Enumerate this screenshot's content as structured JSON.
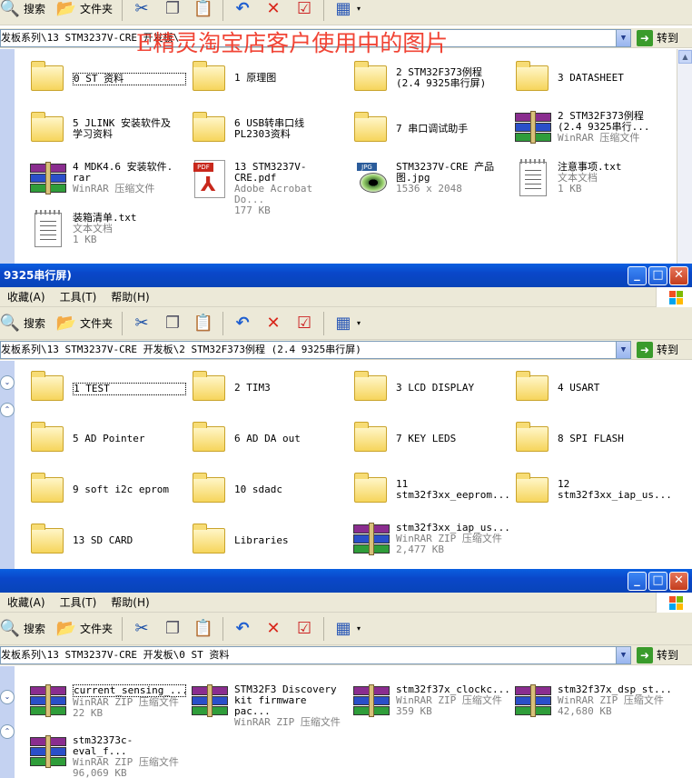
{
  "watermark": "E精灵淘宝店客户使用中的图片",
  "windows": [
    {
      "title": "",
      "menu": [],
      "toolbar": {
        "search": "搜索",
        "folders": "文件夹"
      },
      "address": "发板系列\\13 STM3237V-CRE 开发板\\",
      "goto": "转到",
      "items": [
        {
          "name": "0 ST 资料",
          "sub1": "",
          "sub2": "",
          "type": "folder",
          "selected": true
        },
        {
          "name": "1 原理图",
          "sub1": "",
          "sub2": "",
          "type": "folder"
        },
        {
          "name": "2 STM32F373例程\n(2.4 9325串行屏)",
          "sub1": "",
          "sub2": "",
          "type": "folder"
        },
        {
          "name": "3 DATASHEET",
          "sub1": "",
          "sub2": "",
          "type": "folder"
        },
        {
          "name": "5 JLINK 安装软件及\n学习资料",
          "sub1": "",
          "sub2": "",
          "type": "folder"
        },
        {
          "name": "6 USB转串口线\nPL2303资料",
          "sub1": "",
          "sub2": "",
          "type": "folder"
        },
        {
          "name": "7 串口调试助手",
          "sub1": "",
          "sub2": "",
          "type": "folder"
        },
        {
          "name": "2 STM32F373例程\n(2.4 9325串行...",
          "sub1": "WinRAR 压缩文件",
          "sub2": "",
          "type": "rar"
        },
        {
          "name": "4 MDK4.6 安装软件.\nrar",
          "sub1": "WinRAR 压缩文件",
          "sub2": "",
          "type": "rar"
        },
        {
          "name": "13 STM3237V-CRE.pdf",
          "sub1": "Adobe Acrobat Do...",
          "sub2": "177 KB",
          "type": "pdf"
        },
        {
          "name": "STM3237V-CRE 产品\n图.jpg",
          "sub1": "1536 x 2048",
          "sub2": "",
          "type": "jpg"
        },
        {
          "name": "注意事项.txt",
          "sub1": "文本文档",
          "sub2": "1 KB",
          "type": "txt"
        },
        {
          "name": "装箱清单.txt",
          "sub1": "文本文档",
          "sub2": "1 KB",
          "type": "txt"
        }
      ]
    },
    {
      "title": "9325串行屏)",
      "menu": [
        "收藏(A)",
        "工具(T)",
        "帮助(H)"
      ],
      "toolbar": {
        "search": "搜索",
        "folders": "文件夹"
      },
      "address": "发板系列\\13 STM3237V-CRE 开发板\\2 STM32F373例程 (2.4 9325串行屏)",
      "goto": "转到",
      "items": [
        {
          "name": "1 TEST",
          "type": "folder",
          "selected": true
        },
        {
          "name": "2 TIM3",
          "type": "folder"
        },
        {
          "name": "3 LCD DISPLAY",
          "type": "folder"
        },
        {
          "name": "4 USART",
          "type": "folder"
        },
        {
          "name": "5 AD Pointer",
          "type": "folder"
        },
        {
          "name": "6 AD DA out",
          "type": "folder"
        },
        {
          "name": "7 KEY LEDS",
          "type": "folder"
        },
        {
          "name": "8 SPI FLASH",
          "type": "folder"
        },
        {
          "name": "9 soft i2c eprom",
          "type": "folder"
        },
        {
          "name": "10 sdadc",
          "type": "folder"
        },
        {
          "name": "11\nstm32f3xx_eeprom...",
          "type": "folder"
        },
        {
          "name": "12\nstm32f3xx_iap_us...",
          "type": "folder"
        },
        {
          "name": "13 SD CARD",
          "type": "folder"
        },
        {
          "name": "Libraries",
          "type": "folder"
        },
        {
          "name": "stm32f3xx_iap_us...",
          "sub1": "WinRAR ZIP 压缩文件",
          "sub2": "2,477 KB",
          "type": "rar"
        }
      ]
    },
    {
      "title": "",
      "menu": [
        "收藏(A)",
        "工具(T)",
        "帮助(H)"
      ],
      "toolbar": {
        "search": "搜索",
        "folders": "文件夹"
      },
      "address": "发板系列\\13 STM3237V-CRE 开发板\\0 ST 资料",
      "goto": "转到",
      "items": [
        {
          "name": "current_sensing_...",
          "sub1": "WinRAR ZIP 压缩文件",
          "sub2": "22 KB",
          "type": "rar",
          "selected": true
        },
        {
          "name": "STM32F3 Discovery\nkit firmware pac...",
          "sub1": "WinRAR ZIP 压缩文件",
          "sub2": "",
          "type": "rar"
        },
        {
          "name": "stm32f37x_clockc...",
          "sub1": "WinRAR ZIP 压缩文件",
          "sub2": "359 KB",
          "type": "rar"
        },
        {
          "name": "stm32f37x_dsp_st...",
          "sub1": "WinRAR ZIP 压缩文件",
          "sub2": "42,680 KB",
          "type": "rar"
        },
        {
          "name": "stm32373c-eval_f...",
          "sub1": "WinRAR ZIP 压缩文件",
          "sub2": "96,069 KB",
          "type": "rar"
        }
      ]
    }
  ]
}
